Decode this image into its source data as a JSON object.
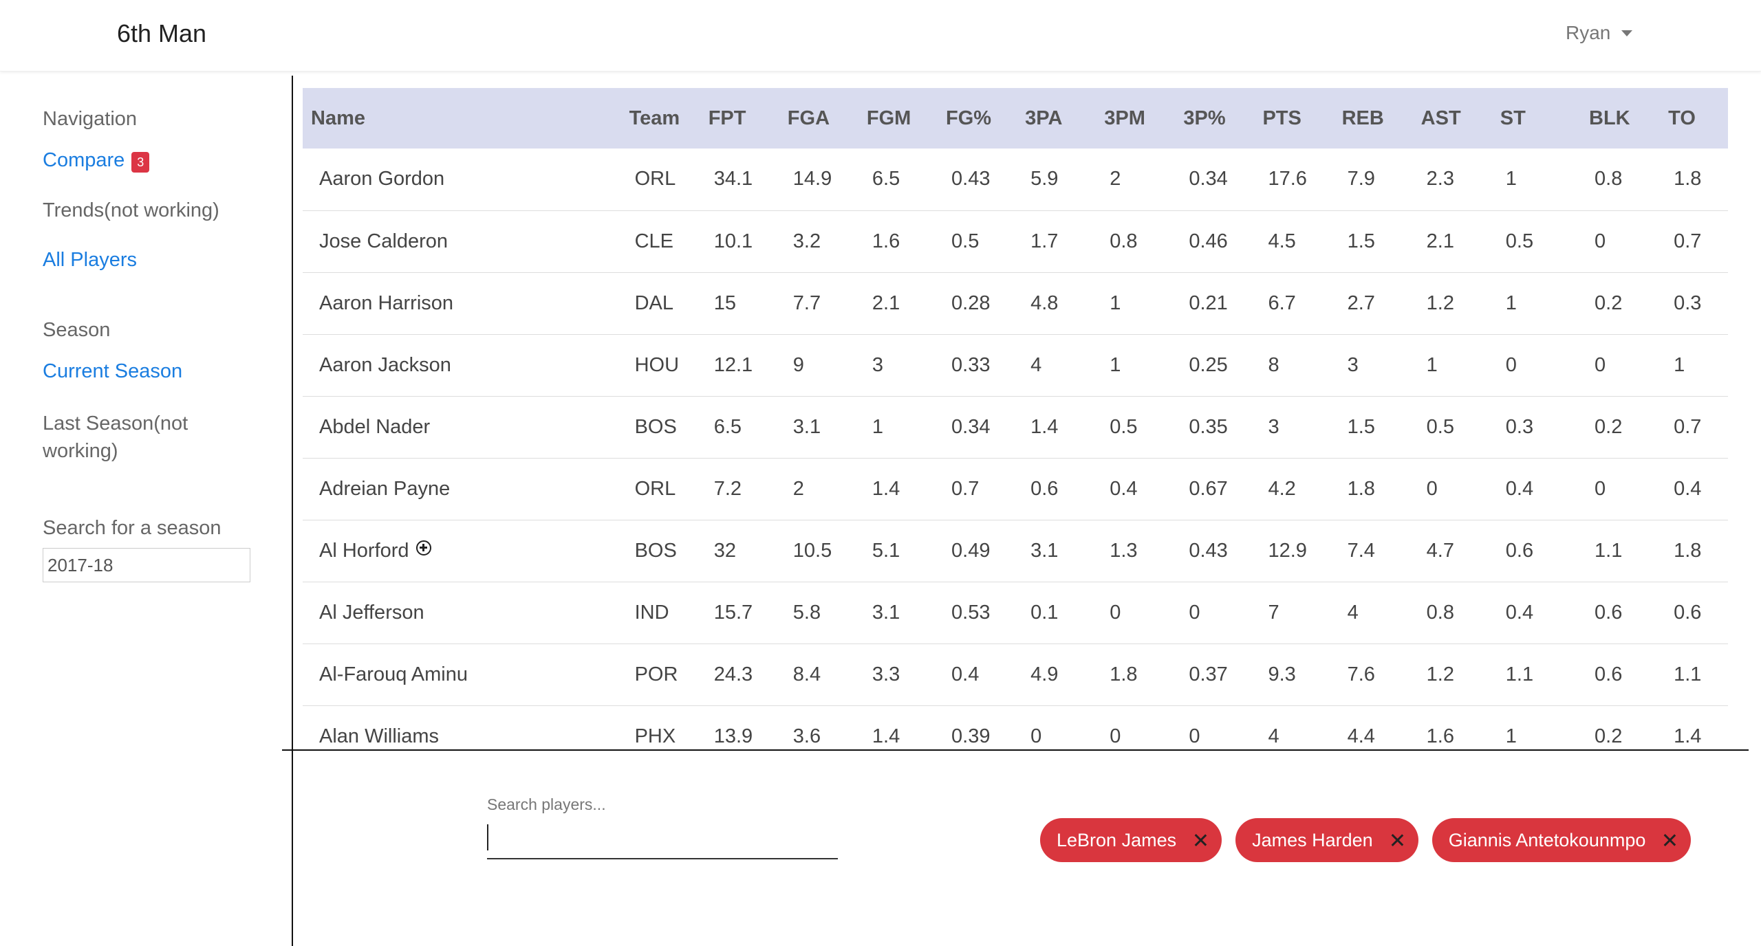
{
  "header": {
    "brand": "6th Man",
    "user": "Ryan"
  },
  "sidebar": {
    "nav_heading": "Navigation",
    "compare_label": "Compare",
    "compare_count": "3",
    "trends_label": "Trends(not working)",
    "all_players_label": "All Players",
    "season_heading": "Season",
    "current_season_label": "Current Season",
    "last_season_label_1": "Last Season(not",
    "last_season_label_2": "working)",
    "search_season_label": "Search for a season",
    "search_season_value": "2017-18"
  },
  "table": {
    "columns": [
      "Name",
      "Team",
      "FPT",
      "FGA",
      "FGM",
      "FG%",
      "3PA",
      "3PM",
      "3P%",
      "PTS",
      "REB",
      "AST",
      "ST",
      "BLK",
      "TO"
    ],
    "rows": [
      {
        "name": "Aaron Gordon",
        "cells": [
          "ORL",
          "34.1",
          "14.9",
          "6.5",
          "0.43",
          "5.9",
          "2",
          "0.34",
          "17.6",
          "7.9",
          "2.3",
          "1",
          "0.8",
          "1.8"
        ]
      },
      {
        "name": "Jose Calderon",
        "cells": [
          "CLE",
          "10.1",
          "3.2",
          "1.6",
          "0.5",
          "1.7",
          "0.8",
          "0.46",
          "4.5",
          "1.5",
          "2.1",
          "0.5",
          "0",
          "0.7"
        ]
      },
      {
        "name": "Aaron Harrison",
        "cells": [
          "DAL",
          "15",
          "7.7",
          "2.1",
          "0.28",
          "4.8",
          "1",
          "0.21",
          "6.7",
          "2.7",
          "1.2",
          "1",
          "0.2",
          "0.3"
        ]
      },
      {
        "name": "Aaron Jackson",
        "cells": [
          "HOU",
          "12.1",
          "9",
          "3",
          "0.33",
          "4",
          "1",
          "0.25",
          "8",
          "3",
          "1",
          "0",
          "0",
          "1"
        ]
      },
      {
        "name": "Abdel Nader",
        "cells": [
          "BOS",
          "6.5",
          "3.1",
          "1",
          "0.34",
          "1.4",
          "0.5",
          "0.35",
          "3",
          "1.5",
          "0.5",
          "0.3",
          "0.2",
          "0.7"
        ]
      },
      {
        "name": "Adreian Payne",
        "cells": [
          "ORL",
          "7.2",
          "2",
          "1.4",
          "0.7",
          "0.6",
          "0.4",
          "0.67",
          "4.2",
          "1.8",
          "0",
          "0.4",
          "0",
          "0.4"
        ]
      },
      {
        "name": "Al Horford",
        "add_icon": "plus-circle-icon",
        "cells": [
          "BOS",
          "32",
          "10.5",
          "5.1",
          "0.49",
          "3.1",
          "1.3",
          "0.43",
          "12.9",
          "7.4",
          "4.7",
          "0.6",
          "1.1",
          "1.8"
        ]
      },
      {
        "name": "Al Jefferson",
        "cells": [
          "IND",
          "15.7",
          "5.8",
          "3.1",
          "0.53",
          "0.1",
          "0",
          "0",
          "7",
          "4",
          "0.8",
          "0.4",
          "0.6",
          "0.6"
        ]
      },
      {
        "name": "Al-Farouq Aminu",
        "cells": [
          "POR",
          "24.3",
          "8.4",
          "3.3",
          "0.4",
          "4.9",
          "1.8",
          "0.37",
          "9.3",
          "7.6",
          "1.2",
          "1.1",
          "0.6",
          "1.1"
        ]
      },
      {
        "name": "Alan Williams",
        "cells": [
          "PHX",
          "13.9",
          "3.6",
          "1.4",
          "0.39",
          "0",
          "0",
          "0",
          "4",
          "4.4",
          "1.6",
          "1",
          "0.2",
          "1.4"
        ]
      }
    ]
  },
  "player_search": {
    "placeholder": "Search players...",
    "value": ""
  },
  "selected_players": [
    "LeBron James",
    "James Harden",
    "Giannis Antetokounmpo"
  ],
  "colors": {
    "accent_link": "#1a7de0",
    "header_bg": "#d9dcef",
    "chip_bg": "#d9363e",
    "badge_bg": "#dc3545"
  }
}
